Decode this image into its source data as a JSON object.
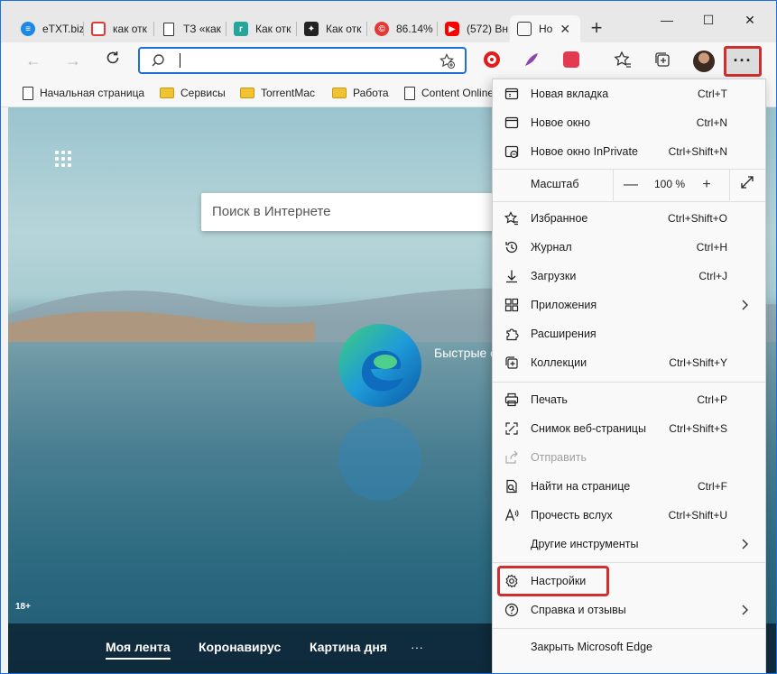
{
  "tabs": [
    {
      "label": "eTXT.biz",
      "icon": "etxt-icon",
      "color": "#1e88e5"
    },
    {
      "label": "как отк",
      "icon": "yandex-icon",
      "color": "#e53935"
    },
    {
      "label": "ТЗ «как",
      "icon": "document-icon",
      "color": "#ffffff"
    },
    {
      "label": "Как отк",
      "icon": "page-icon",
      "color": "#26a69a"
    },
    {
      "label": "Как отк",
      "icon": "black-square-icon",
      "color": "#222222"
    },
    {
      "label": "86.14%",
      "icon": "copyright-icon",
      "color": "#e53935"
    },
    {
      "label": "(572) Вн",
      "icon": "youtube-icon",
      "color": "#ff0000"
    },
    {
      "label": "Но",
      "icon": "newtab-icon",
      "color": "#ffffff"
    }
  ],
  "window_controls": {
    "minimize": "—",
    "maximize": "☐",
    "close": "✕"
  },
  "favorites": [
    {
      "label": "Начальная страница",
      "type": "page"
    },
    {
      "label": "Сервисы",
      "type": "folder"
    },
    {
      "label": "TorrentMac",
      "type": "folder"
    },
    {
      "label": "Работа",
      "type": "folder"
    },
    {
      "label": "Content Online",
      "type": "page"
    }
  ],
  "address": {
    "value": ""
  },
  "newtab_page": {
    "search_placeholder": "Поиск в Интернете",
    "quick_links": "Быстрые с",
    "age_badge": "18+",
    "bottom_nav": [
      "Моя лента",
      "Коронавирус",
      "Картина дня",
      "···"
    ]
  },
  "menu": {
    "items_top": [
      {
        "label": "Новая вкладка",
        "shortcut": "Ctrl+T",
        "icon": "new-tab-icon"
      },
      {
        "label": "Новое окно",
        "shortcut": "Ctrl+N",
        "icon": "new-window-icon"
      },
      {
        "label": "Новое окно InPrivate",
        "shortcut": "Ctrl+Shift+N",
        "icon": "inprivate-icon"
      }
    ],
    "zoom": {
      "label": "Масштаб",
      "value": "100 %",
      "minus": "—",
      "plus": "+"
    },
    "items_mid": [
      {
        "label": "Избранное",
        "shortcut": "Ctrl+Shift+O",
        "icon": "favorites-icon"
      },
      {
        "label": "Журнал",
        "shortcut": "Ctrl+H",
        "icon": "history-icon"
      },
      {
        "label": "Загрузки",
        "shortcut": "Ctrl+J",
        "icon": "downloads-icon"
      },
      {
        "label": "Приложения",
        "shortcut": "",
        "icon": "apps-icon",
        "submenu": true
      },
      {
        "label": "Расширения",
        "shortcut": "",
        "icon": "extensions-icon"
      },
      {
        "label": "Коллекции",
        "shortcut": "Ctrl+Shift+Y",
        "icon": "collections-icon"
      }
    ],
    "items_tools": [
      {
        "label": "Печать",
        "shortcut": "Ctrl+P",
        "icon": "print-icon"
      },
      {
        "label": "Снимок веб-страницы",
        "shortcut": "Ctrl+Shift+S",
        "icon": "screenshot-icon"
      },
      {
        "label": "Отправить",
        "shortcut": "",
        "icon": "share-icon",
        "disabled": true
      },
      {
        "label": "Найти на странице",
        "shortcut": "Ctrl+F",
        "icon": "find-icon"
      },
      {
        "label": "Прочесть вслух",
        "shortcut": "Ctrl+Shift+U",
        "icon": "read-aloud-icon"
      },
      {
        "label": "Другие инструменты",
        "shortcut": "",
        "icon": "",
        "submenu": true
      }
    ],
    "items_bottom": [
      {
        "label": "Настройки",
        "shortcut": "",
        "icon": "settings-icon"
      },
      {
        "label": "Справка и отзывы",
        "shortcut": "",
        "icon": "help-icon",
        "submenu": true
      }
    ],
    "close_label": "Закрыть Microsoft Edge"
  },
  "colors": {
    "accent": "#1e6fd9",
    "highlight": "#d12e2e"
  }
}
